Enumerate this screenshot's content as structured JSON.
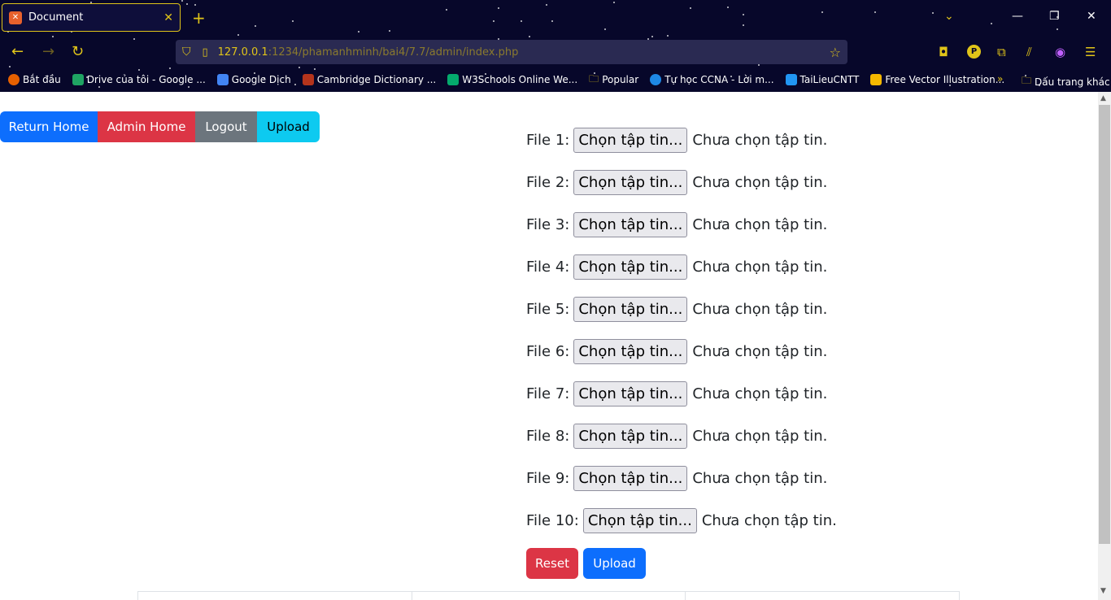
{
  "browser": {
    "tab_title": "Document",
    "tab_favicon": "XAMPP",
    "url_host": "127.0.0.1",
    "url_path": ":1234/phamanhminh/bai4/7.7/admin/index.php",
    "bookmarks": [
      {
        "label": "Bắt đầu",
        "color": "#e66000"
      },
      {
        "label": "Drive của tôi - Google ...",
        "color": "#1fa463"
      },
      {
        "label": "Google Dịch",
        "color": "#4285f4"
      },
      {
        "label": "Cambridge Dictionary ...",
        "color": "#b5341c"
      },
      {
        "label": "W3Schools Online We...",
        "color": "#04aa6d"
      },
      {
        "label": "Popular",
        "color": "#e0c419"
      },
      {
        "label": "Tự học CCNA - Lời m...",
        "color": "#1e88e5"
      },
      {
        "label": "TaiLieuCNTT",
        "color": "#2196f3"
      },
      {
        "label": "Free Vector Illustration...",
        "color": "#f5b800"
      }
    ],
    "other_bookmarks": "Dấu trang khác"
  },
  "nav": {
    "return_home": "Return Home",
    "admin_home": "Admin Home",
    "logout": "Logout",
    "upload": "Upload"
  },
  "files": [
    {
      "label": "File 1:",
      "button": "Chọn tập tin...",
      "status": "Chưa chọn tập tin."
    },
    {
      "label": "File 2:",
      "button": "Chọn tập tin...",
      "status": "Chưa chọn tập tin."
    },
    {
      "label": "File 3:",
      "button": "Chọn tập tin...",
      "status": "Chưa chọn tập tin."
    },
    {
      "label": "File 4:",
      "button": "Chọn tập tin...",
      "status": "Chưa chọn tập tin."
    },
    {
      "label": "File 5:",
      "button": "Chọn tập tin...",
      "status": "Chưa chọn tập tin."
    },
    {
      "label": "File 6:",
      "button": "Chọn tập tin...",
      "status": "Chưa chọn tập tin."
    },
    {
      "label": "File 7:",
      "button": "Chọn tập tin...",
      "status": "Chưa chọn tập tin."
    },
    {
      "label": "File 8:",
      "button": "Chọn tập tin...",
      "status": "Chưa chọn tập tin."
    },
    {
      "label": "File 9:",
      "button": "Chọn tập tin...",
      "status": "Chưa chọn tập tin."
    },
    {
      "label": "File 10:",
      "button": "Chọn tập tin...",
      "status": "Chưa chọn tập tin."
    }
  ],
  "actions": {
    "reset": "Reset",
    "upload": "Upload"
  }
}
